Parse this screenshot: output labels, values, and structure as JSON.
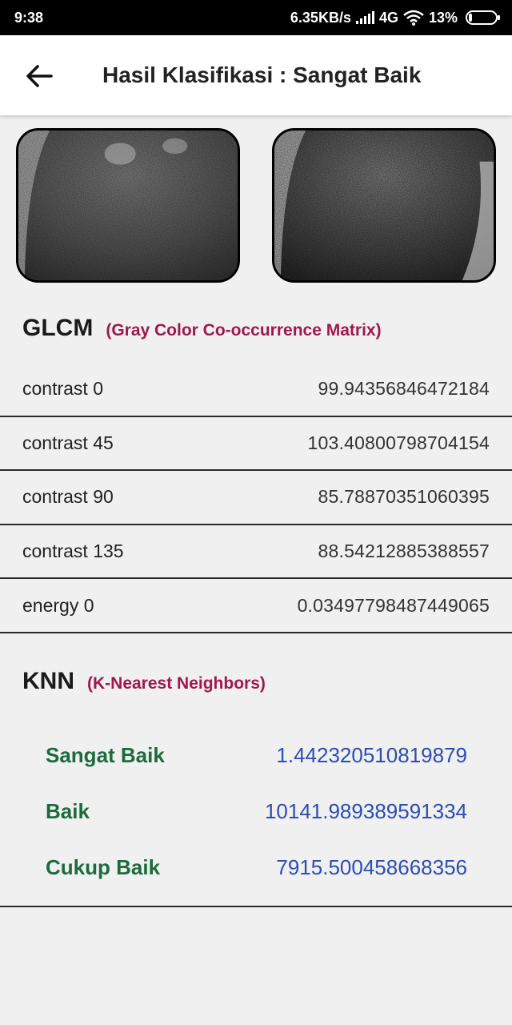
{
  "status_bar": {
    "time": "9:38",
    "network_speed": "6.35KB/s",
    "network_type": "4G",
    "battery_percent": "13%",
    "battery_level": 0.13
  },
  "app_bar": {
    "back_icon": "arrow-left-icon",
    "title": "Hasil Klasifikasi : Sangat Baik"
  },
  "images": [
    {
      "name": "original-image"
    },
    {
      "name": "processed-image"
    }
  ],
  "glcm": {
    "title": "GLCM",
    "subtitle": "(Gray Color Co-occurrence Matrix)",
    "rows": [
      {
        "label": "contrast 0",
        "value": "99.94356846472184"
      },
      {
        "label": "contrast 45",
        "value": "103.40800798704154"
      },
      {
        "label": "contrast 90",
        "value": "85.78870351060395"
      },
      {
        "label": "contrast 135",
        "value": "88.54212885388557"
      },
      {
        "label": "energy 0",
        "value": "0.03497798487449065"
      }
    ]
  },
  "knn": {
    "title": "KNN",
    "subtitle": "(K-Nearest Neighbors)",
    "rows": [
      {
        "label": "Sangat Baik",
        "value": "1.442320510819879"
      },
      {
        "label": "Baik",
        "value": "10141.989389591334"
      },
      {
        "label": "Cukup Baik",
        "value": "7915.500458668356"
      }
    ]
  },
  "colors": {
    "subtitle": "#a0184c",
    "knn_label": "#1d6b3c",
    "knn_value": "#2a4db8"
  }
}
